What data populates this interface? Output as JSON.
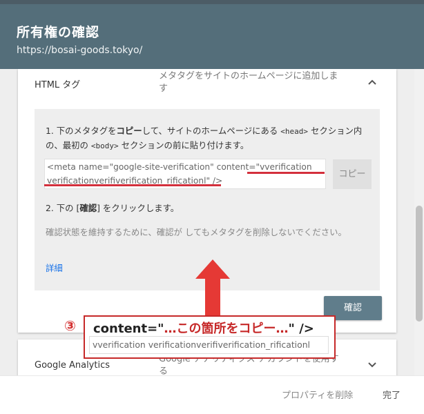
{
  "dialog": {
    "title": "所有権の確認",
    "url": "https://bosai-goods.tokyo/"
  },
  "html_tag": {
    "label": "HTML タグ",
    "description": "メタタグをサイトのホームページに追加します",
    "step1_num": "1. 下のメタタグを",
    "step1_bold": "コピー",
    "step1_rest_a": "して、サイトのホームページにある ",
    "step1_head": "<head>",
    "step1_rest_b": " セクション内の、最初の ",
    "step1_body": "<body>",
    "step1_rest_c": " セクションの前に貼り付けます。",
    "meta_line1": "<meta name=\"google-site-verification\" content=\"vverification",
    "meta_line2": "verificationverifiverification_rificationl\"  />",
    "copy_button": "コピー",
    "step2_a": "2. 下の [",
    "step2_bold": "確認",
    "step2_b": "] をクリックします。",
    "note": "確認状態を維持するために、確認が                    してもメタタグを削除しないでください。",
    "detail_link": "詳細",
    "confirm_button": "確認"
  },
  "annotation": {
    "number": "③",
    "text_a": "content=\"",
    "text_red": "…この箇所をコピー…",
    "text_b": "\" />",
    "code_text": "vverification verificationverifiverification_rificationl"
  },
  "analytics": {
    "label": "Google Analytics",
    "description": "Google アナリティクス アカウントを使用する"
  },
  "footer": {
    "remove_property": "プロパティを削除",
    "done": "完了"
  },
  "colors": {
    "header": "#546e7a",
    "accent_red": "#d32f3c",
    "confirm_button": "#607d8b",
    "link": "#1a73e8"
  }
}
